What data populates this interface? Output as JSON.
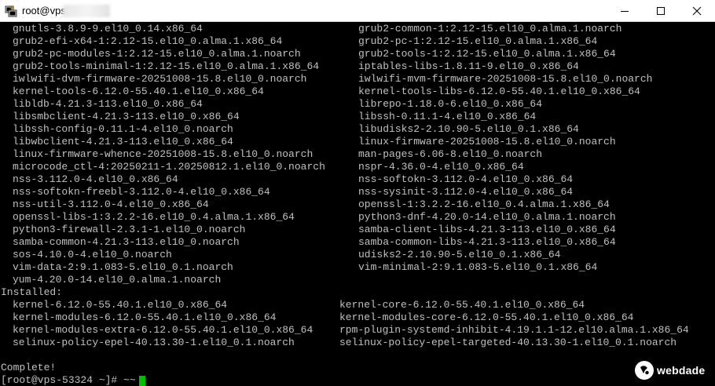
{
  "window": {
    "title": "root@vps",
    "icon": "putty-terminal-icon",
    "controls": {
      "minimize": "minimize-icon",
      "maximize": "maximize-icon",
      "close": "close-icon"
    }
  },
  "terminal": {
    "upgraded_pairs": [
      [
        "gnutls-3.8.9-9.el10_0.14.x86_64",
        "grub2-common-1:2.12-15.el10_0.alma.1.noarch"
      ],
      [
        "grub2-efi-x64-1:2.12-15.el10_0.alma.1.x86_64",
        "grub2-pc-1:2.12-15.el10_0.alma.1.x86_64"
      ],
      [
        "grub2-pc-modules-1:2.12-15.el10_0.alma.1.noarch",
        "grub2-tools-1:2.12-15.el10_0.alma.1.x86_64"
      ],
      [
        "grub2-tools-minimal-1:2.12-15.el10_0.alma.1.x86_64",
        "iptables-libs-1.8.11-9.el10_0.x86_64"
      ],
      [
        "iwlwifi-dvm-firmware-20251008-15.8.el10_0.noarch",
        "iwlwifi-mvm-firmware-20251008-15.8.el10_0.noarch"
      ],
      [
        "kernel-tools-6.12.0-55.40.1.el10_0.x86_64",
        "kernel-tools-libs-6.12.0-55.40.1.el10_0.x86_64"
      ],
      [
        "libldb-4.21.3-113.el10_0.x86_64",
        "librepo-1.18.0-6.el10_0.x86_64"
      ],
      [
        "libsmbclient-4.21.3-113.el10_0.x86_64",
        "libssh-0.11.1-4.el10_0.x86_64"
      ],
      [
        "libssh-config-0.11.1-4.el10_0.noarch",
        "libudisks2-2.10.90-5.el10_0.1.x86_64"
      ],
      [
        "libwbclient-4.21.3-113.el10_0.x86_64",
        "linux-firmware-20251008-15.8.el10_0.noarch"
      ],
      [
        "linux-firmware-whence-20251008-15.8.el10_0.noarch",
        "man-pages-6.06-8.el10_0.noarch"
      ],
      [
        "microcode_ctl-4:20250211-1.20250812.1.el10_0.noarch",
        "nspr-4.36.0-4.el10_0.x86_64"
      ],
      [
        "nss-3.112.0-4.el10_0.x86_64",
        "nss-softokn-3.112.0-4.el10_0.x86_64"
      ],
      [
        "nss-softokn-freebl-3.112.0-4.el10_0.x86_64",
        "nss-sysinit-3.112.0-4.el10_0.x86_64"
      ],
      [
        "nss-util-3.112.0-4.el10_0.x86_64",
        "openssl-1:3.2.2-16.el10_0.4.alma.1.x86_64"
      ],
      [
        "openssl-libs-1:3.2.2-16.el10_0.4.alma.1.x86_64",
        "python3-dnf-4.20.0-14.el10_0.alma.1.noarch"
      ],
      [
        "python3-firewall-2.3.1-1.el10_0.noarch",
        "samba-client-libs-4.21.3-113.el10_0.x86_64"
      ],
      [
        "samba-common-4.21.3-113.el10_0.noarch",
        "samba-common-libs-4.21.3-113.el10_0.x86_64"
      ],
      [
        "sos-4.10.0-4.el10_0.noarch",
        "udisks2-2.10.90-5.el10_0.1.x86_64"
      ],
      [
        "vim-data-2:9.1.083-5.el10_0.1.noarch",
        "vim-minimal-2:9.1.083-5.el10_0.1.x86_64"
      ],
      [
        "yum-4.20.0-14.el10_0.alma.1.noarch",
        ""
      ]
    ],
    "installed_heading": "Installed:",
    "installed_pairs": [
      [
        "kernel-6.12.0-55.40.1.el10_0.x86_64",
        "kernel-core-6.12.0-55.40.1.el10_0.x86_64"
      ],
      [
        "kernel-modules-6.12.0-55.40.1.el10_0.x86_64",
        "kernel-modules-core-6.12.0-55.40.1.el10_0.x86_64"
      ],
      [
        "kernel-modules-extra-6.12.0-55.40.1.el10_0.x86_64",
        "rpm-plugin-systemd-inhibit-4.19.1.1-12.el10.alma.1.x86_64"
      ],
      [
        "selinux-policy-epel-40.13.30-1.el10_0.1.noarch",
        "selinux-policy-epel-targeted-40.13.30-1.el10_0.1.noarch"
      ]
    ],
    "complete": "Complete!",
    "prompt": "[root@vps-53324 ~]# ~~",
    "text_color": "#c0c0c0",
    "cursor_color": "#00c000"
  },
  "watermark": {
    "text": "webdade",
    "icon": "webdade-logo-icon"
  }
}
